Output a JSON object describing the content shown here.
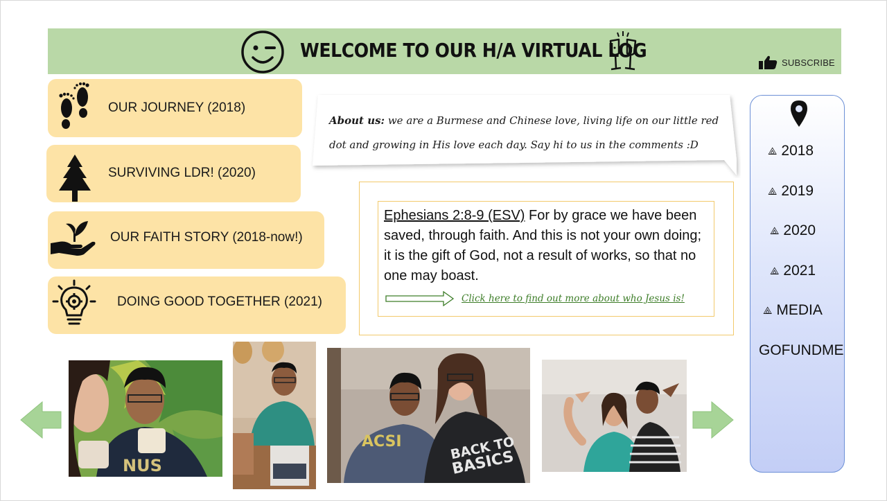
{
  "header": {
    "title": "WELCOME TO OUR H/A VIRTUAL LOG",
    "subscribe_label": "SUBSCRIBE",
    "icons": [
      "winking-smiley-icon",
      "champagne-glasses-icon",
      "thumbs-up-icon"
    ]
  },
  "journey": [
    {
      "label": "OUR JOURNEY (2018)",
      "icon": "footprints-icon"
    },
    {
      "label": "SURVIVING LDR! (2020)",
      "icon": "tree-icon"
    },
    {
      "label": "OUR FAITH STORY (2018-now!)",
      "icon": "hand-sprout-icon"
    },
    {
      "label": "DOING GOOD TOGETHER (2021)",
      "icon": "lightbulb-gear-icon"
    }
  ],
  "about": {
    "heading": "About us:",
    "text": " we are a Burmese and Chinese love, living life on our little red dot and growing in His love each day. Say hi to us in the comments :D"
  },
  "verse": {
    "reference": "Ephesians 2:8-9 (ESV)",
    "text": " For by grace we have been saved, through faith. And this is not your own doing; it is the gift of God, not a result of works, so that no one may boast.",
    "link_label": "Click here to find out more about who Jesus is!"
  },
  "sidebar": {
    "items": [
      {
        "label": "2018",
        "arrow": "⟁"
      },
      {
        "label": "2019",
        "arrow": "⟁"
      },
      {
        "label": "2020",
        "arrow": "⟁"
      },
      {
        "label": "2021",
        "arrow": "⟁"
      },
      {
        "label": "MEDIA",
        "arrow": "⟁"
      },
      {
        "label": "GOFUNDME",
        "arrow": ""
      }
    ],
    "icon": "location-pin-icon"
  },
  "gallery": {
    "photo_count": 4,
    "prev_icon": "chevron-left-icon",
    "next_icon": "chevron-right-icon"
  },
  "colors": {
    "header_bg": "#b9d8a7",
    "button_bg": "#fde3a6",
    "verse_border": "#f2c96b",
    "link_green": "#3d7d28",
    "sidebar_border": "#6b8fd6",
    "chevron_green": "#a7d497"
  }
}
